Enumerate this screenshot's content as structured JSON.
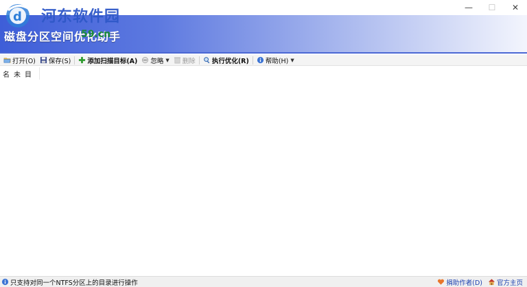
{
  "window": {
    "title": "磁盘分区空间优化助手",
    "controls": [
      "—",
      "☐",
      "✕"
    ]
  },
  "watermark": {
    "name": "河东软件园",
    "url": "59.cn"
  },
  "toolbar": {
    "open_label": "打开(O)",
    "save_label": "保存(S)",
    "add_target_label": "添加扫描目标(A)",
    "ignore_label": "忽略",
    "delete_label": "删除",
    "run_label": "执行优化(R)",
    "help_label": "帮助(H)"
  },
  "list": {
    "columns": [
      "名",
      "未",
      "目"
    ]
  },
  "status": {
    "message": "只支持对同一个NTFS分区上的目录进行操作",
    "donate_label": "捐助作者(D)",
    "homepage_label": "官方主页"
  },
  "colors": {
    "banner_start": "#3e5ed8",
    "banner_end": "#f3f5fd",
    "link": "#1a3fb0"
  }
}
